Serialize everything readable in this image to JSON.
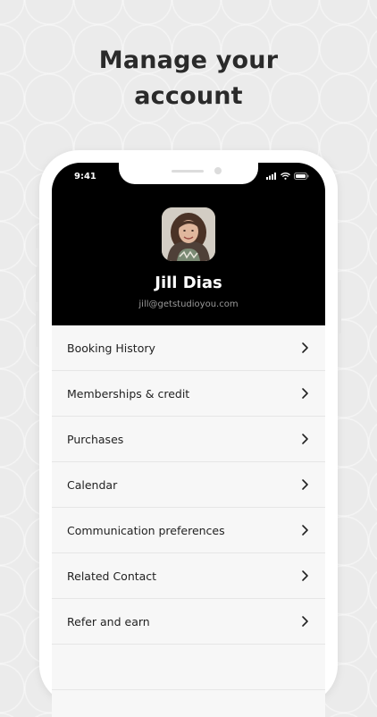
{
  "headline": {
    "line1": "Manage your",
    "line2": "account"
  },
  "status_bar": {
    "time": "9:41",
    "icons": [
      "signal-icon",
      "wifi-icon",
      "battery-icon"
    ]
  },
  "profile": {
    "name": "Jill Dias",
    "email": "jill@getstudioyou.com"
  },
  "menu": {
    "items": [
      {
        "label": "Booking History",
        "icon": "chevron-right-icon"
      },
      {
        "label": "Memberships & credit",
        "icon": "chevron-right-icon"
      },
      {
        "label": "Purchases",
        "icon": "chevron-right-icon"
      },
      {
        "label": "Calendar",
        "icon": "chevron-right-icon"
      },
      {
        "label": "Communication preferences",
        "icon": "chevron-right-icon"
      },
      {
        "label": "Related Contact",
        "icon": "chevron-right-icon"
      },
      {
        "label": "Refer and earn",
        "icon": "chevron-right-icon"
      }
    ]
  },
  "colors": {
    "header_bg": "#000000",
    "background": "#ebebeb",
    "list_bg": "#f7f7f7",
    "text": "#222222"
  }
}
